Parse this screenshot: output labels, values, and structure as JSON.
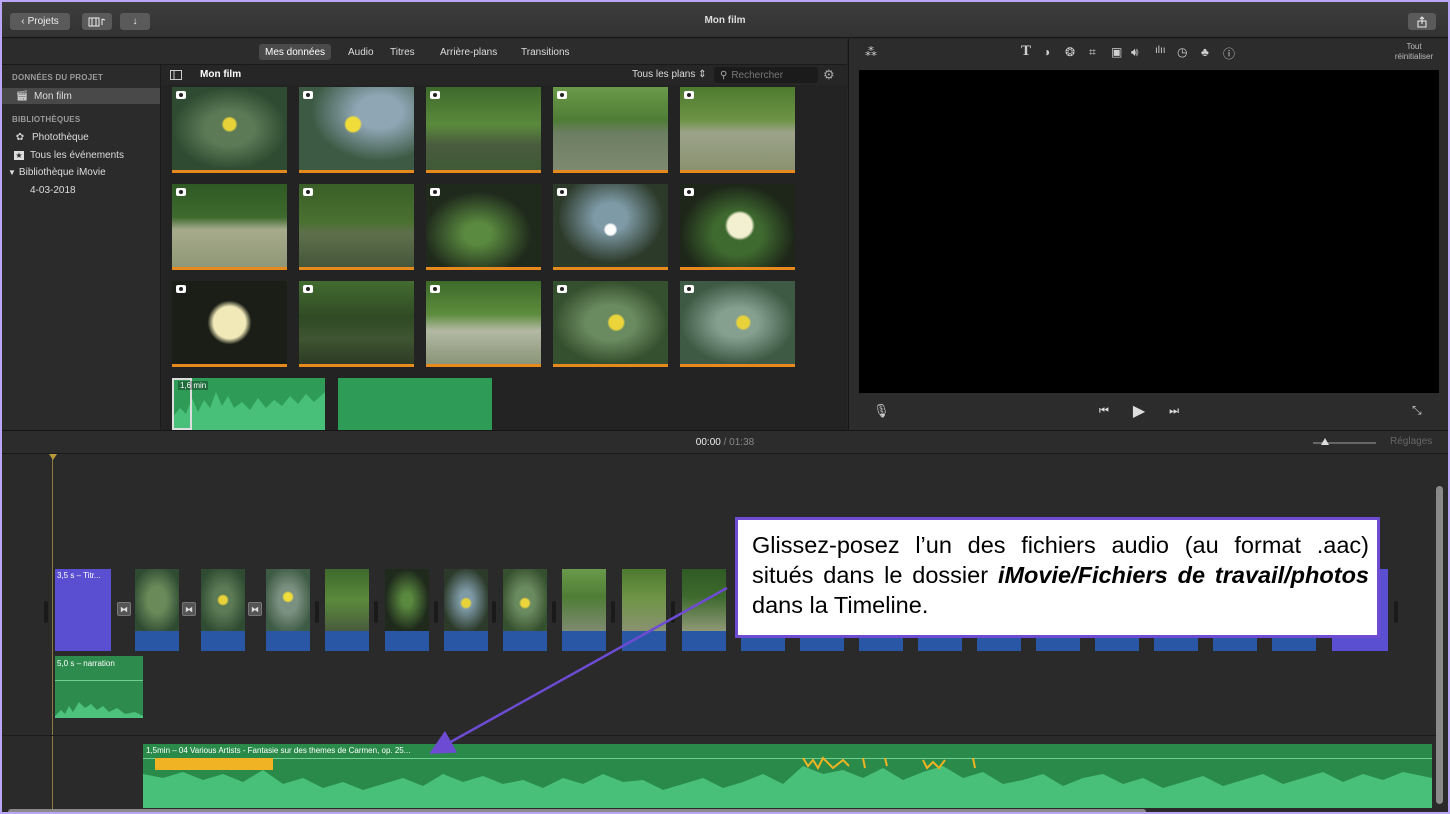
{
  "titlebar": {
    "back_label": "Projets",
    "title": "Mon film",
    "media_icon": "filmstrip-music-icon",
    "import_icon": "download-arrow-icon",
    "share_icon": "share-icon"
  },
  "browser": {
    "tabs": [
      "Mes données",
      "Audio",
      "Titres",
      "Arrière-plans",
      "Transitions"
    ],
    "active_tab": "Mes données",
    "header_title": "Mon film",
    "filter": "Tous les plans",
    "search_placeholder": "Rechercher"
  },
  "sidebar": {
    "project_heading": "DONNÉES DU PROJET",
    "project_item": "Mon film",
    "libraries_heading": "BIBLIOTHÈQUES",
    "items": [
      "Photothèque",
      "Tous les événements"
    ],
    "library_name": "Bibliothèque iMovie",
    "event": "4-03-2018"
  },
  "media": {
    "audio_clip_label": "1,6 min",
    "thumb_count": 15
  },
  "viewer": {
    "reset_label": "Tout réinitialiser",
    "tools": [
      "magic-wand-icon",
      "title-T-icon",
      "color-balance-icon",
      "color-palette-icon",
      "crop-icon",
      "camera-stabilize-icon",
      "volume-icon",
      "equalizer-icon",
      "speed-icon",
      "filter-icon",
      "info-icon"
    ]
  },
  "timeline": {
    "timecode": "00:00",
    "duration": "01:38",
    "settings_label": "Réglages",
    "title_clip_label": "3,5 s – Titr...",
    "narration_label": "5,0 s – narration",
    "music_label": "1,5min – 04 Various Artists - Fantasie sur des themes de Carmen, op. 25..."
  },
  "callout": {
    "text_before": "Glissez-posez l’un des fichiers audio (au format .aac) situés dans le dossier ",
    "bold_text": "iMovie/Fichiers de travail/photos",
    "text_after": " dans la Timeline."
  },
  "colors": {
    "accent_purple": "#6d4bd2",
    "audio_green": "#2e8b4e",
    "clip_blue": "#2a56a6",
    "title_purple": "#5a4fd0",
    "orange": "#e68a1d"
  }
}
